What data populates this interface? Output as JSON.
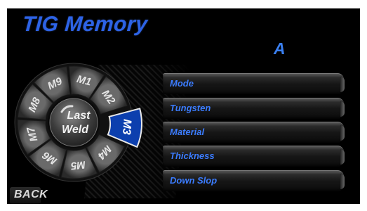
{
  "screen": {
    "title": "TIG Memory",
    "unit_letter": "A"
  },
  "dial": {
    "center_line1": "Last",
    "center_line2": "Weld",
    "selected": "M3",
    "memories": [
      "M1",
      "M2",
      "M3",
      "M4",
      "M5",
      "M6",
      "M7",
      "M8",
      "M9"
    ]
  },
  "params": [
    {
      "label": "Mode"
    },
    {
      "label": "Tungsten"
    },
    {
      "label": "Material"
    },
    {
      "label": "Thickness"
    },
    {
      "label": "Down Slop"
    }
  ],
  "footer": {
    "back_label": "BACK"
  },
  "colors": {
    "accent_blue": "#2d63e6",
    "selected_segment": "#0c3fae",
    "label_blue": "#3b7cff"
  }
}
